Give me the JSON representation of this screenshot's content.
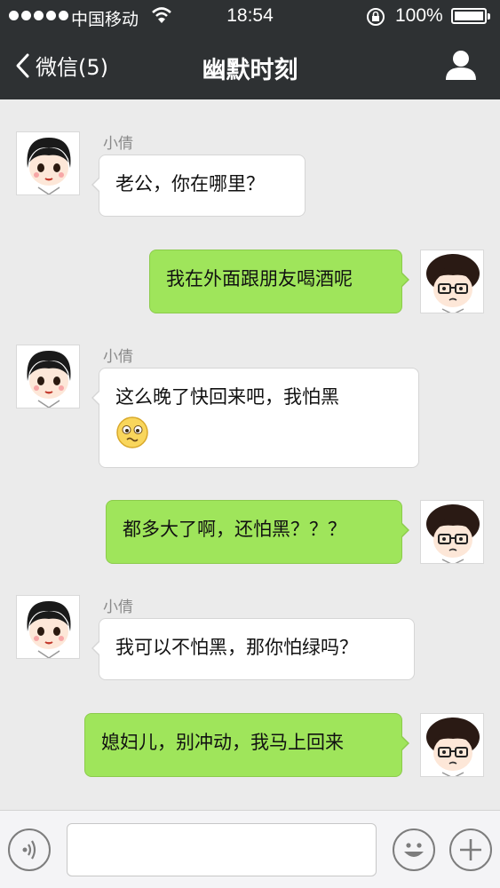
{
  "status_bar": {
    "carrier": "中国移动",
    "time": "18:54",
    "battery": "100%"
  },
  "nav": {
    "back_label": "微信(5)",
    "title": "幽默时刻"
  },
  "messages": [
    {
      "side": "in",
      "sender": "小倩",
      "text": "老公，你在哪里？"
    },
    {
      "side": "out",
      "text": "我在外面跟朋友喝酒呢"
    },
    {
      "side": "in",
      "sender": "小倩",
      "text": "这么晚了快回来吧，我怕黑",
      "emoji": "worried-face-emoji"
    },
    {
      "side": "out",
      "text": "都多大了啊，还怕黑？？？"
    },
    {
      "side": "in",
      "sender": "小倩",
      "text": "我可以不怕黑，那你怕绿吗？"
    },
    {
      "side": "out",
      "text": "媳妇儿，别冲动，我马上回来"
    }
  ],
  "icons": {
    "voice": "voice-input-icon",
    "emoji": "emoji-icon",
    "more": "plus-icon",
    "profile": "profile-icon",
    "back": "chevron-left-icon"
  },
  "colors": {
    "header_bg": "#2e3133",
    "chat_bg": "#ebebeb",
    "outgoing_bubble": "#9fe55b",
    "incoming_bubble": "#ffffff"
  }
}
